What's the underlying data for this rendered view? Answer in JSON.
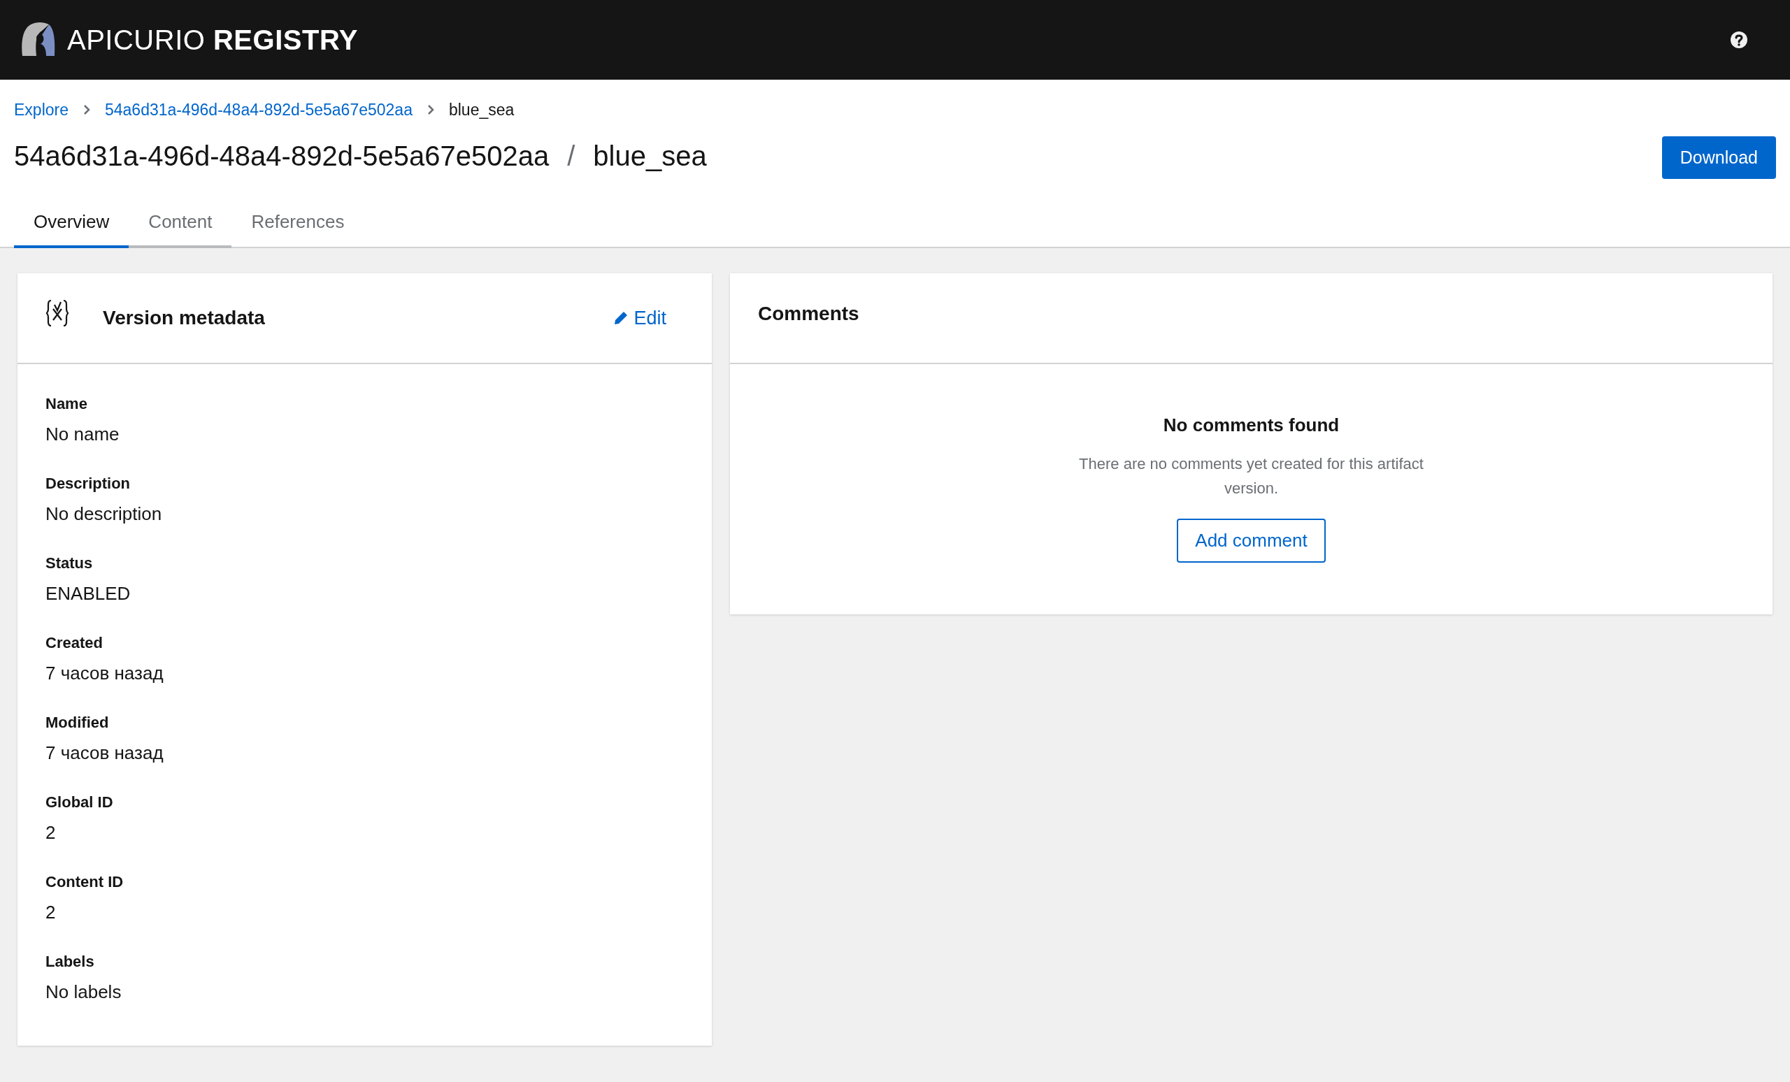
{
  "header": {
    "logo_light": "APICURIO",
    "logo_bold": "REGISTRY"
  },
  "breadcrumb": [
    {
      "label": "Explore",
      "kind": "link"
    },
    {
      "label": "54a6d31a-496d-48a4-892d-5e5a67e502aa",
      "kind": "link"
    },
    {
      "label": "blue_sea",
      "kind": "current"
    }
  ],
  "title": {
    "group": "54a6d31a-496d-48a4-892d-5e5a67e502aa",
    "separator": "/",
    "artifact": "blue_sea"
  },
  "download_button": "Download",
  "tabs": [
    {
      "label": "Overview",
      "selected": true,
      "hovered": false
    },
    {
      "label": "Content",
      "selected": false,
      "hovered": true
    },
    {
      "label": "References",
      "selected": false,
      "hovered": false
    }
  ],
  "metadata": {
    "title": "Version metadata",
    "edit": "Edit",
    "fields": [
      {
        "label": "Name",
        "value": "No name"
      },
      {
        "label": "Description",
        "value": "No description"
      },
      {
        "label": "Status",
        "value": "ENABLED"
      },
      {
        "label": "Created",
        "value": "7 часов назад"
      },
      {
        "label": "Modified",
        "value": "7 часов назад"
      },
      {
        "label": "Global ID",
        "value": "2"
      },
      {
        "label": "Content ID",
        "value": "2"
      },
      {
        "label": "Labels",
        "value": "No labels"
      }
    ]
  },
  "comments": {
    "title": "Comments",
    "empty_title": "No comments found",
    "empty_text": "There are no comments yet created for this artifact version.",
    "button": "Add comment"
  }
}
